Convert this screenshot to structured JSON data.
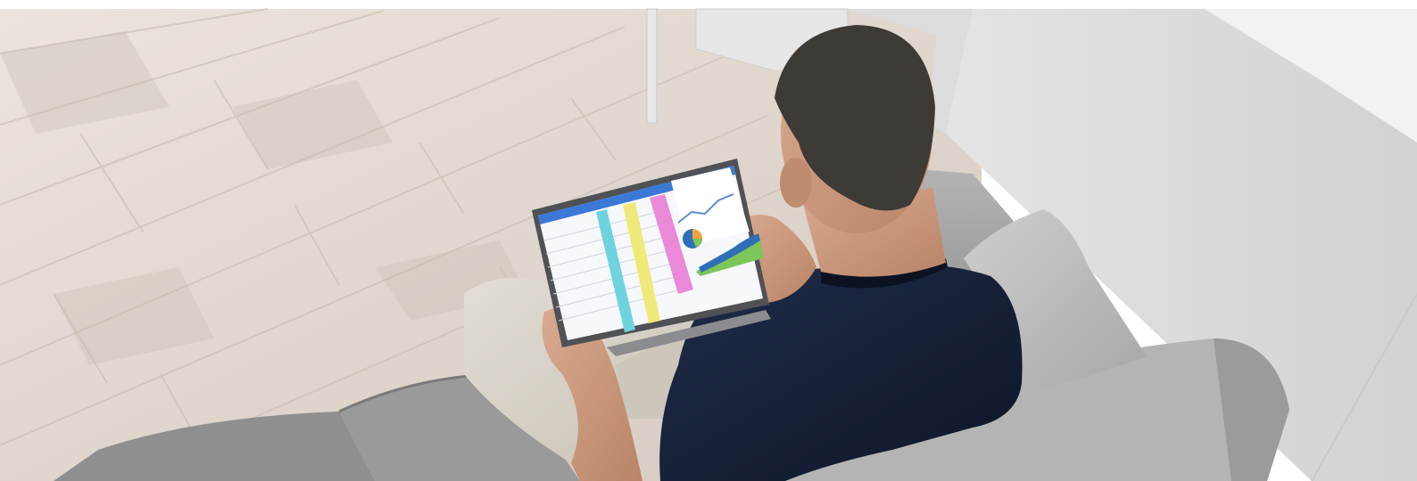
{
  "image": {
    "alt": "",
    "colors": {
      "floor_light": "#e7dfd8",
      "floor_mid": "#d8cec5",
      "floor_dark": "#c9beb4",
      "wall": "#dedede",
      "wall_light": "#efefef",
      "sofa": "#a9a9a9",
      "sofa_dark": "#8e8e8e",
      "sofa_light": "#c2c2c2",
      "shirt": "#17223a",
      "skin": "#c99a80",
      "hair": "#3e3a36",
      "pants": "#d8d3c8",
      "tablet_frame": "#505254",
      "screen": "#f7f8fb",
      "sheet_cyan": "#6fd3df",
      "sheet_yellow": "#efe97a",
      "sheet_pink": "#eb89d9",
      "sheet_header": "#3b79d6",
      "chart_blue": "#2f6fb8",
      "chart_green": "#7cc65a",
      "chart_orange": "#f0a23a"
    }
  }
}
